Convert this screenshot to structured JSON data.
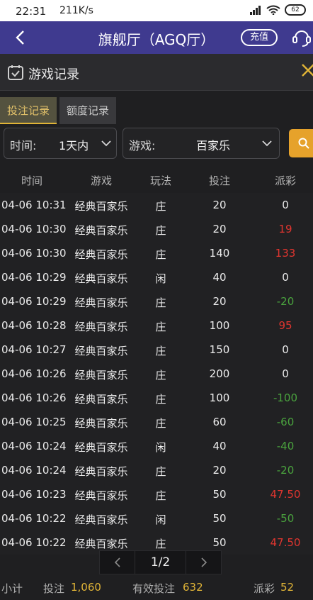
{
  "status_bar": {
    "time": "22:31",
    "speed": "211K/s",
    "battery": "62"
  },
  "header": {
    "title": "旗舰厅（AGQ厅）",
    "recharge_label": "充值"
  },
  "panel": {
    "title": "游戏记录",
    "tabs": [
      {
        "label": "投注记录"
      },
      {
        "label": "额度记录"
      }
    ]
  },
  "filters": {
    "time_label": "时间:",
    "time_value": "1天内",
    "game_label": "游戏:",
    "game_value": "百家乐"
  },
  "table": {
    "headers": [
      "时间",
      "游戏",
      "玩法",
      "投注",
      "派彩"
    ],
    "rows": [
      {
        "time": "04-06 10:31",
        "game": "经典百家乐",
        "play": "庄",
        "bet": "20",
        "payout": "0",
        "sign": "zero"
      },
      {
        "time": "04-06 10:30",
        "game": "经典百家乐",
        "play": "庄",
        "bet": "20",
        "payout": "19",
        "sign": "pos"
      },
      {
        "time": "04-06 10:30",
        "game": "经典百家乐",
        "play": "庄",
        "bet": "140",
        "payout": "133",
        "sign": "pos"
      },
      {
        "time": "04-06 10:29",
        "game": "经典百家乐",
        "play": "闲",
        "bet": "40",
        "payout": "0",
        "sign": "zero"
      },
      {
        "time": "04-06 10:29",
        "game": "经典百家乐",
        "play": "庄",
        "bet": "20",
        "payout": "-20",
        "sign": "neg"
      },
      {
        "time": "04-06 10:28",
        "game": "经典百家乐",
        "play": "庄",
        "bet": "100",
        "payout": "95",
        "sign": "pos"
      },
      {
        "time": "04-06 10:27",
        "game": "经典百家乐",
        "play": "庄",
        "bet": "150",
        "payout": "0",
        "sign": "zero"
      },
      {
        "time": "04-06 10:26",
        "game": "经典百家乐",
        "play": "庄",
        "bet": "200",
        "payout": "0",
        "sign": "zero"
      },
      {
        "time": "04-06 10:26",
        "game": "经典百家乐",
        "play": "庄",
        "bet": "100",
        "payout": "-100",
        "sign": "neg"
      },
      {
        "time": "04-06 10:25",
        "game": "经典百家乐",
        "play": "庄",
        "bet": "60",
        "payout": "-60",
        "sign": "neg"
      },
      {
        "time": "04-06 10:24",
        "game": "经典百家乐",
        "play": "闲",
        "bet": "40",
        "payout": "-40",
        "sign": "neg"
      },
      {
        "time": "04-06 10:24",
        "game": "经典百家乐",
        "play": "庄",
        "bet": "20",
        "payout": "-20",
        "sign": "neg"
      },
      {
        "time": "04-06 10:23",
        "game": "经典百家乐",
        "play": "庄",
        "bet": "50",
        "payout": "47.50",
        "sign": "pos"
      },
      {
        "time": "04-06 10:22",
        "game": "经典百家乐",
        "play": "闲",
        "bet": "50",
        "payout": "-50",
        "sign": "neg"
      },
      {
        "time": "04-06 10:22",
        "game": "经典百家乐",
        "play": "庄",
        "bet": "50",
        "payout": "47.50",
        "sign": "pos"
      }
    ]
  },
  "pagination": {
    "label": "1/2"
  },
  "summary": {
    "subtotal_label": "小计",
    "bet_label": "投注",
    "bet_value": "1,060",
    "valid_bet_label": "有效投注",
    "valid_bet_value": "632",
    "payout_label": "派彩",
    "payout_value": "52"
  },
  "colors": {
    "header_bg": "#3f3a8f",
    "accent_gold": "#e0b437",
    "search_orange": "#e6a22b",
    "positive_red": "#e0352f",
    "negative_green": "#4aa33e"
  }
}
